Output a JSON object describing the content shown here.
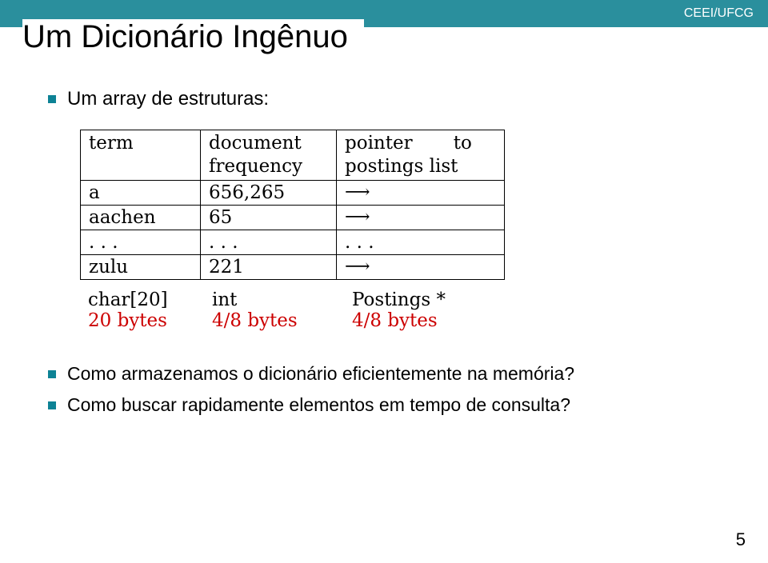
{
  "header": {
    "org": "CEEI/UFCG"
  },
  "title": "Um Dicionário Ingênuo",
  "bullets": {
    "intro": "Um array de estruturas:",
    "q1": "Como armazenamos o dicionário eficientemente na memória?",
    "q2": "Como buscar rapidamente elementos em tempo de consulta?"
  },
  "table": {
    "headers": {
      "c1": "term",
      "c2_l1": "document",
      "c2_l2": "frequency",
      "c3_l1": "pointer",
      "c3_l2": "to",
      "c3_l3": "postings list"
    },
    "rows": [
      {
        "term": "a",
        "freq": "656,265",
        "ptr": "⟶"
      },
      {
        "term": "aachen",
        "freq": "65",
        "ptr": "⟶"
      },
      {
        "term": ". . .",
        "freq": ". . .",
        "ptr": ". . ."
      },
      {
        "term": "zulu",
        "freq": "221",
        "ptr": "⟶"
      }
    ]
  },
  "types": {
    "c1": "char[20]",
    "c2": "int",
    "c3": "Postings *",
    "b1": "20 bytes",
    "b2": "4/8 bytes",
    "b3": "4/8 bytes"
  },
  "page": "5"
}
